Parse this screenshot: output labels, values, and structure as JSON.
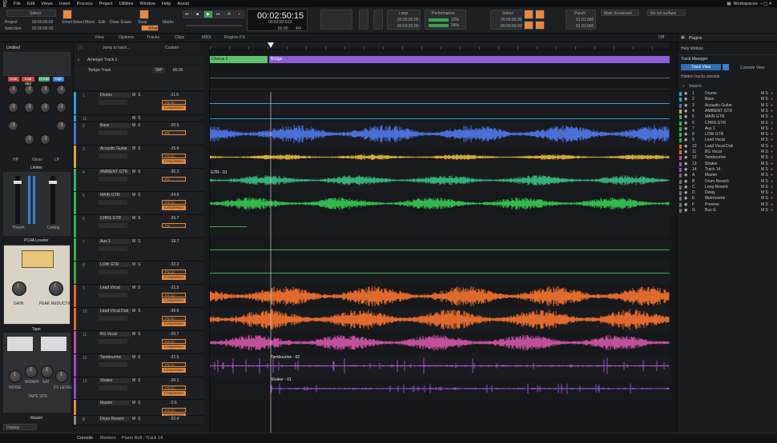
{
  "app": {
    "logo": "Sonar"
  },
  "menu": [
    "File",
    "Edit",
    "Views",
    "Insert",
    "Process",
    "Project",
    "Utilities",
    "Window",
    "Help",
    "Assist"
  ],
  "workspace": "Workspaces",
  "toolbar": {
    "select_label": "Select",
    "project_label": "Project",
    "selection_label": "Selection",
    "project_val": "00:00:00:00",
    "tools": [
      "Smart",
      "Select",
      "Move",
      "Edit",
      "Draw",
      "Erase",
      "Snap",
      "Marks"
    ],
    "snap_val": "Whole",
    "marks_val": "Marks",
    "time": "00:02:50:15",
    "time_sub": "00:02:50:513",
    "tempo": "60.95",
    "meter": "4/4",
    "loop_label": "Loop",
    "loop_start": "00:00:00:00",
    "loop_end": "00:03:20:00",
    "perf_label": "Performance",
    "perf_cpu": "12%",
    "perf_disk": "34%",
    "select_start": "00:00:00:00",
    "select_end": "00:00:00:00",
    "punch_label": "Punch",
    "punch_in": "01:01:000",
    "punch_out": "01:01:000",
    "layout_label": "Main Screenset",
    "no_surface": "No ctrl surface"
  },
  "subbar": {
    "view": "View",
    "options": "Options",
    "tracks": "Tracks",
    "clips": "Clips",
    "midi": "MIDI",
    "region_fx": "Region FX",
    "jump": "Jump to track...",
    "custom": "Custom",
    "off": "Off"
  },
  "inspector": {
    "title": "Untitled",
    "btn_low": "Low",
    "btn_lowmid": "Low Mid",
    "btn_himid": "Hi Mid",
    "btn_high": "High",
    "eq_labels": [
      "HP",
      "Gloss",
      "LP"
    ],
    "limiter": "Limiter",
    "threshold": "Thresh",
    "ceiling": "Ceiling",
    "pc4a": "PC4A Leveler",
    "pc4a_gain": "GAIN",
    "pc4a_peak": "PEAK REDUCTION",
    "tape": "Tape",
    "tape_knobs": [
      "NOISE",
      "WOW/F",
      "SAT",
      "FX LEVEL"
    ],
    "tape_speed": "TAPE SPD",
    "master": "Master",
    "display": "Display"
  },
  "arranger": {
    "track": "Arranger Track 1",
    "sections": [
      "Chorus 2",
      "Bridge"
    ]
  },
  "tempo_track": {
    "name": "Tempo Track",
    "tap": "TAP",
    "value": "60.95"
  },
  "tracks": [
    {
      "num": "1",
      "name": "Drums",
      "vol": "-11.5",
      "fx": "FX (1)",
      "plug": "Compressor",
      "color": "#2e9fd6"
    },
    {
      "num": "11",
      "name": "",
      "vol": "",
      "fx": "",
      "plug": "",
      "color": "#2e9fd6"
    },
    {
      "num": "2",
      "name": "Bass",
      "vol": "-20.5",
      "fx": "FX",
      "plug": "",
      "color": "#4b6fd8"
    },
    {
      "num": "3",
      "name": "Acoustic Guitar",
      "vol": "-25.4",
      "fx": "FX (1)",
      "plug": "Compressor",
      "color": "#d6a93a"
    },
    {
      "num": "4",
      "name": "AMBIENT GTR",
      "vol": "-30.3",
      "fx": "FX",
      "plug": "",
      "color": "#35b07a"
    },
    {
      "num": "5",
      "name": "MAIN GTR",
      "vol": "-24.8",
      "fx": "FX (1)",
      "plug": "Compressor",
      "color": "#33b84b"
    },
    {
      "num": "6",
      "name": "CHRS GTR",
      "vol": "-20.7",
      "fx": "FX",
      "plug": "",
      "color": "#3eaa4a"
    },
    {
      "num": "7",
      "name": "Aux 1",
      "vol": "-18.7",
      "fx": "",
      "plug": "",
      "color": "#3fae55"
    },
    {
      "num": "8",
      "name": "LOW GTR",
      "vol": "-32.2",
      "fx": "FX (1)",
      "plug": "Compressor",
      "color": "#3aa948"
    },
    {
      "num": "9",
      "name": "Lead Vocal",
      "vol": "-21.5",
      "fx": "FX (1)",
      "plug": "Compressor",
      "color": "#e06a2e"
    },
    {
      "num": "10",
      "name": "Lead Vocal Dub",
      "vol": "-36.6",
      "fx": "FX (1)",
      "plug": "Compressor",
      "color": "#e06a2e"
    },
    {
      "num": "11",
      "name": "BG Vocal",
      "vol": "-20.7",
      "fx": "FX (1)",
      "plug": "Compressor",
      "color": "#c0509a"
    },
    {
      "num": "12",
      "name": "Tambourine",
      "vol": "-21.6",
      "fx": "FX (1)",
      "plug": "Compressor",
      "color": "#9a4fc0"
    },
    {
      "num": "13",
      "name": "Shaker",
      "vol": "-20.1",
      "fx": "FX (1)",
      "plug": "Compressor",
      "color": "#8a4ec0"
    },
    {
      "num": "",
      "name": "Master",
      "vol": "-2.6",
      "fx": "FX (1)",
      "plug": "Compressor",
      "color": "#e58a3e"
    },
    {
      "num": "B",
      "name": "Drum Reverb",
      "vol": "-20.4",
      "fx": "",
      "plug": "",
      "color": "#8a8d92"
    }
  ],
  "clip_labels": {
    "gtr": "GTR - 01",
    "tamb": "Tambourine - 02",
    "shaker": "Shaker - 01"
  },
  "right": {
    "tabs": [
      "Plugins",
      "Help Module"
    ],
    "track_manager": "Track Manager",
    "track_view": "Track View",
    "console_view": "Console View",
    "hidden": "Hidden tracks presets",
    "search": "Search",
    "rows": [
      {
        "n": "1",
        "name": "Drums"
      },
      {
        "n": "2",
        "name": "Bass"
      },
      {
        "n": "3",
        "name": "Acoustic Guitar"
      },
      {
        "n": "4",
        "name": "AMBIENT GTR"
      },
      {
        "n": "5",
        "name": "MAIN GTR"
      },
      {
        "n": "6",
        "name": "CHRS GTR"
      },
      {
        "n": "7",
        "name": "Aux 1"
      },
      {
        "n": "8",
        "name": "LOW GTR"
      },
      {
        "n": "9",
        "name": "Lead Vocal"
      },
      {
        "n": "10",
        "name": "Lead Vocal Dub"
      },
      {
        "n": "11",
        "name": "BG Vocal"
      },
      {
        "n": "12",
        "name": "Tambourine"
      },
      {
        "n": "13",
        "name": "Shaker"
      },
      {
        "n": "14",
        "name": "Track 14"
      },
      {
        "n": "A",
        "name": "Master"
      },
      {
        "n": "B",
        "name": "Drum Reverb"
      },
      {
        "n": "C",
        "name": "Long Reverb"
      },
      {
        "n": "D",
        "name": "Delay"
      },
      {
        "n": "E",
        "name": "Metronome"
      },
      {
        "n": "F",
        "name": "Preview"
      },
      {
        "n": "G",
        "name": "Bus G"
      }
    ]
  },
  "status": {
    "console": "Console",
    "markers": "Markers",
    "info": "Piano Roll - Track 14"
  }
}
